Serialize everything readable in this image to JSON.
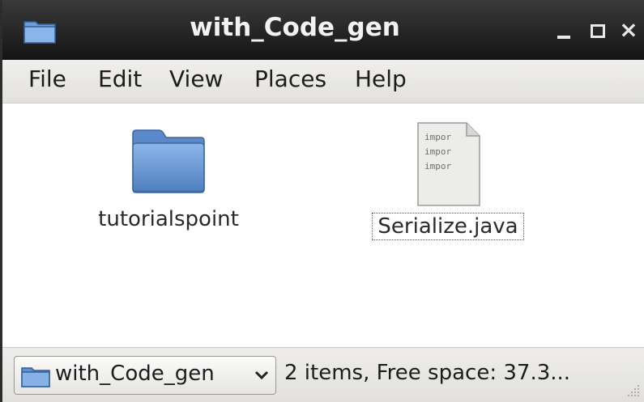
{
  "window": {
    "title": "with_Code_gen"
  },
  "menu": {
    "items": [
      "File",
      "Edit",
      "View",
      "Places",
      "Help"
    ]
  },
  "files": [
    {
      "name": "tutorialspoint",
      "kind": "folder-icon"
    },
    {
      "name": "Serialize.java",
      "kind": "text-file-icon",
      "preview_lines": [
        "impor",
        "impor",
        "impor"
      ],
      "selected": true
    }
  ],
  "statusbar": {
    "location": "with_Code_gen",
    "status": "2 items, Free space: 37.3..."
  },
  "colors": {
    "titlebar": "#1e1e1e",
    "folder": "#5f8fcf",
    "menubar": "#ebeae7"
  }
}
